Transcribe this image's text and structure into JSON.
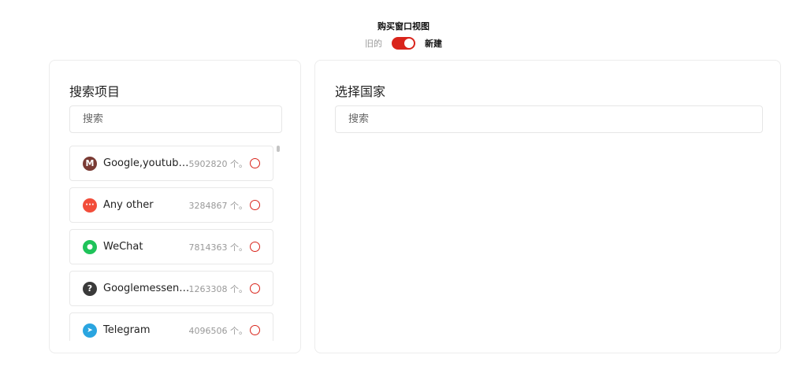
{
  "header": {
    "title": "购买窗口视图",
    "toggle_old": "旧的",
    "toggle_new": "新建",
    "toggle_state": "new"
  },
  "left_panel": {
    "title": "搜索项目",
    "search_placeholder": "搜索",
    "items": [
      {
        "name": "Google,youtube,...",
        "count": "5902820 个。",
        "icon": "gmail-icon",
        "icon_color": "#7a3b34",
        "icon_glyph": "M"
      },
      {
        "name": "Any other",
        "count": "3284867 个。",
        "icon": "more-dots-icon",
        "icon_color": "#f24d3a",
        "icon_glyph": "···"
      },
      {
        "name": "WeChat",
        "count": "7814363 个。",
        "icon": "wechat-icon",
        "icon_color": "#1fc35a",
        "icon_glyph": "●"
      },
      {
        "name": "Googlemesseng...",
        "count": "1263308 个。",
        "icon": "question-icon",
        "icon_color": "#3a3a3a",
        "icon_glyph": "?"
      },
      {
        "name": "Telegram",
        "count": "4096506 个。",
        "icon": "telegram-icon",
        "icon_color": "#2aa5e0",
        "icon_glyph": "➤"
      }
    ]
  },
  "right_panel": {
    "title": "选择国家",
    "search_placeholder": "搜索"
  },
  "colors": {
    "accent": "#d9241b",
    "border": "#ececec"
  }
}
